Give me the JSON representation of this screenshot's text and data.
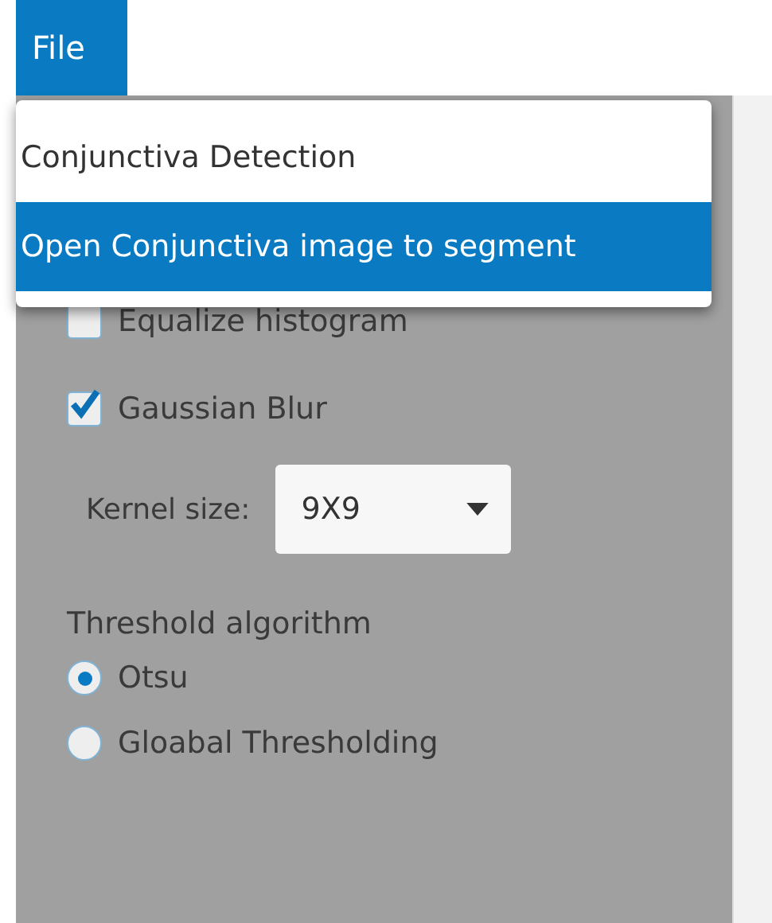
{
  "menu_bar": {
    "menus": [
      {
        "label": "File",
        "selected": true
      }
    ]
  },
  "file_menu": {
    "items": [
      {
        "label": "Conjunctiva Detection",
        "selected": false
      },
      {
        "label": "Open Conjunctiva image to segment",
        "selected": true
      }
    ]
  },
  "options": {
    "checkboxes": [
      {
        "label": "Equalize histogram",
        "checked": false
      },
      {
        "label": "Gaussian Blur",
        "checked": true
      }
    ],
    "kernel_size": {
      "label": "Kernel size:",
      "value": "9X9"
    },
    "threshold": {
      "label": "Threshold algorithm",
      "options": [
        {
          "label": "Otsu",
          "selected": true
        },
        {
          "label": "Gloabal Thresholding",
          "selected": false
        }
      ]
    }
  }
}
